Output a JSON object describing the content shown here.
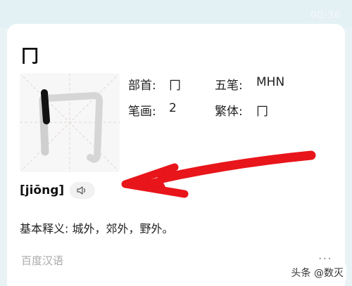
{
  "status": {
    "timer": "00:36"
  },
  "entry": {
    "character": "冂",
    "radical_label": "部首:",
    "radical_value": "冂",
    "wubi_label": "五笔:",
    "wubi_value": "MHN",
    "strokes_label": "笔画:",
    "strokes_value": "2",
    "traditional_label": "繁体:",
    "traditional_value": "冂",
    "pinyin": "[jiōng]",
    "definition_label": "基本释义:",
    "definition_text": " 城外，郊外，野外。"
  },
  "footer": {
    "source": "百度汉语",
    "more": "···"
  },
  "watermark": "头条 @数灭",
  "colors": {
    "background": "#e9f3f6",
    "card": "#ffffff",
    "arrow": "#e8151b",
    "muted": "#a9a9a9"
  },
  "icons": [
    "speaker-icon",
    "more-icon"
  ]
}
